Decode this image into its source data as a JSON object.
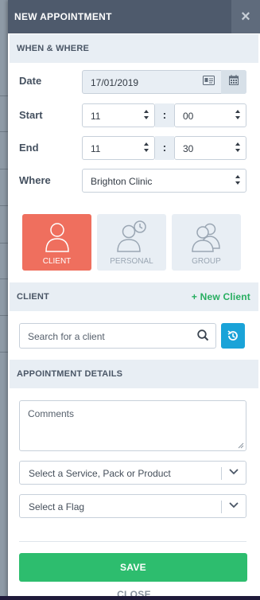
{
  "header": {
    "title": "NEW APPOINTMENT",
    "close_glyph": "×"
  },
  "when_where": {
    "section_label": "WHEN & WHERE",
    "date_label": "Date",
    "date_value": "17/01/2019",
    "start_label": "Start",
    "start_hour": "11",
    "start_minute": "00",
    "end_label": "End",
    "end_hour": "11",
    "end_minute": "30",
    "time_separator": ":",
    "where_label": "Where",
    "where_value": "Brighton Clinic"
  },
  "appointment_types": [
    {
      "label": "CLIENT",
      "icon": "user-icon",
      "active": true
    },
    {
      "label": "PERSONAL",
      "icon": "user-clock-icon",
      "active": false
    },
    {
      "label": "GROUP",
      "icon": "users-icon",
      "active": false
    }
  ],
  "client": {
    "section_label": "CLIENT",
    "new_client_label": "+ New Client",
    "search_placeholder": "Search for a client"
  },
  "details": {
    "section_label": "APPOINTMENT DETAILS",
    "comments_placeholder": "Comments",
    "service_placeholder": "Select a Service, Pack or Product",
    "flag_placeholder": "Select a Flag"
  },
  "footer": {
    "save_label": "SAVE",
    "close_label": "CLOSE"
  },
  "colors": {
    "header_bg": "#4e5a6c",
    "section_bg": "#e8eef4",
    "active_type": "#ef6f5e",
    "new_client_green": "#27ae60",
    "save_green": "#2dbd6e",
    "refresh_blue": "#1aa3d8"
  }
}
